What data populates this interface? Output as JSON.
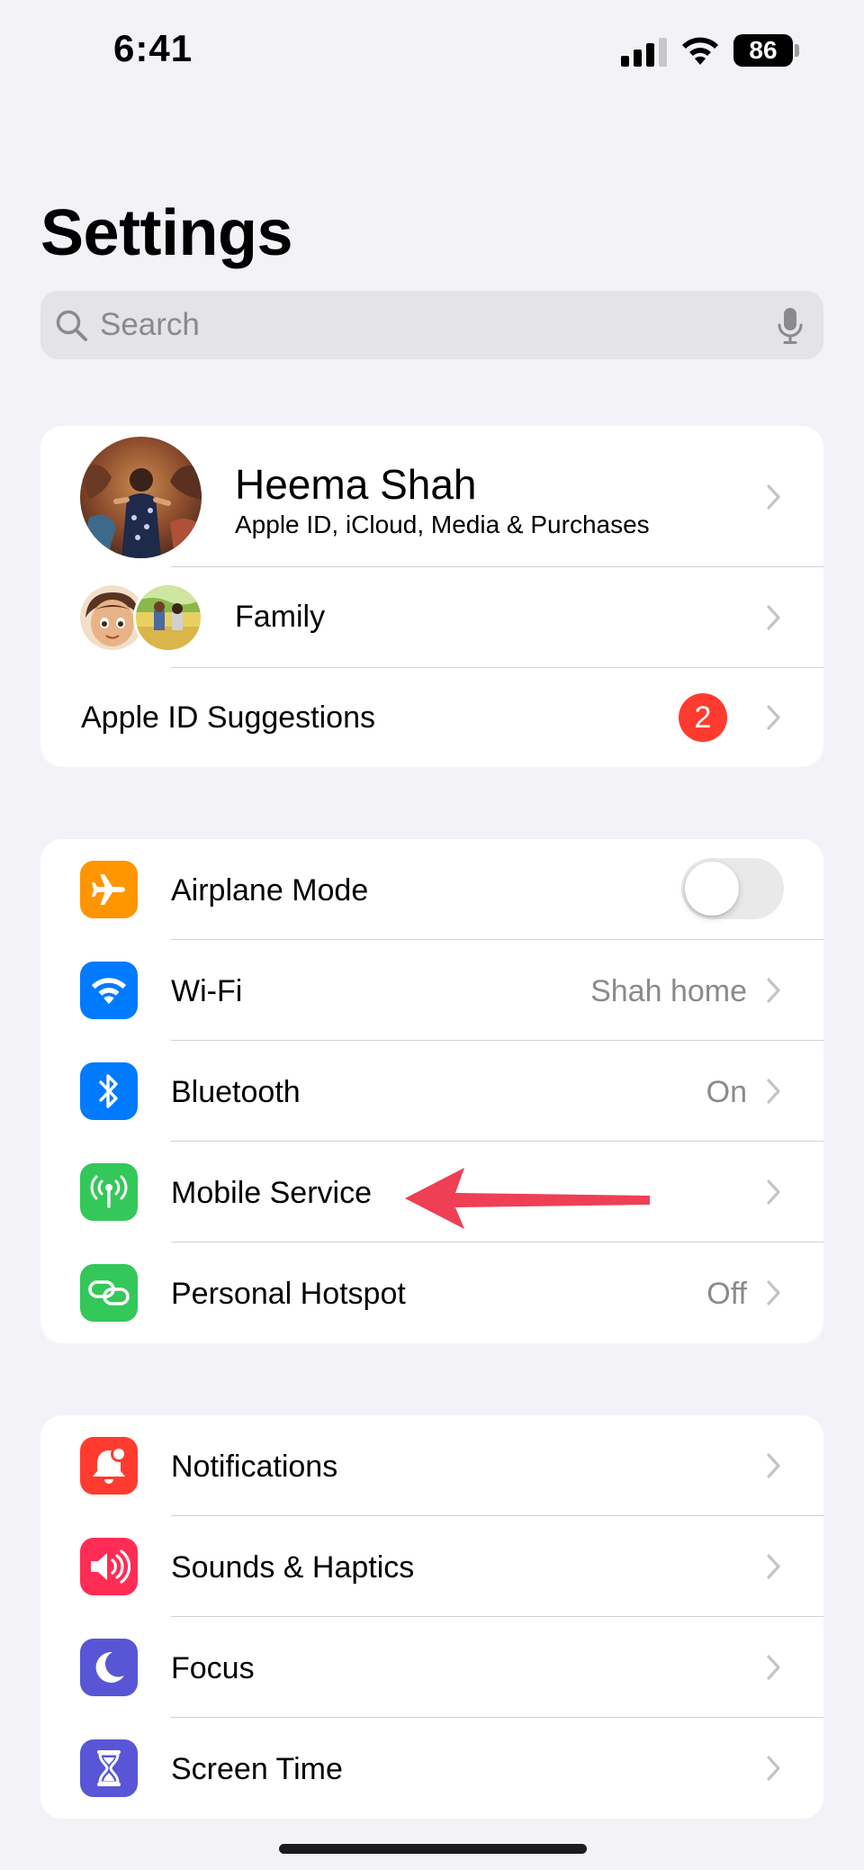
{
  "status_bar": {
    "time": "6:41",
    "battery_level": "86"
  },
  "page": {
    "title": "Settings"
  },
  "search": {
    "placeholder": "Search"
  },
  "account": {
    "name": "Heema Shah",
    "subtitle": "Apple ID, iCloud, Media & Purchases",
    "family_label": "Family",
    "suggestions_label": "Apple ID Suggestions",
    "suggestions_badge": "2"
  },
  "connectivity": [
    {
      "label": "Airplane Mode",
      "icon": "airplane-icon",
      "color": "#ff9500",
      "toggle_on": false
    },
    {
      "label": "Wi-Fi",
      "value": "Shah home",
      "icon": "wifi-icon",
      "color": "#007aff"
    },
    {
      "label": "Bluetooth",
      "value": "On",
      "icon": "bluetooth-icon",
      "color": "#007aff"
    },
    {
      "label": "Mobile Service",
      "icon": "antenna-icon",
      "color": "#34c759"
    },
    {
      "label": "Personal Hotspot",
      "value": "Off",
      "icon": "hotspot-link-icon",
      "color": "#34c759"
    }
  ],
  "general": [
    {
      "label": "Notifications",
      "icon": "bell-icon",
      "color": "#ff3b30"
    },
    {
      "label": "Sounds & Haptics",
      "icon": "speaker-icon",
      "color": "#ff2d55"
    },
    {
      "label": "Focus",
      "icon": "moon-icon",
      "color": "#5856d6"
    },
    {
      "label": "Screen Time",
      "icon": "hourglass-icon",
      "color": "#5856d6"
    }
  ],
  "colors": {
    "annotation_arrow": "#ee3f55",
    "badge": "#ff3b30"
  }
}
